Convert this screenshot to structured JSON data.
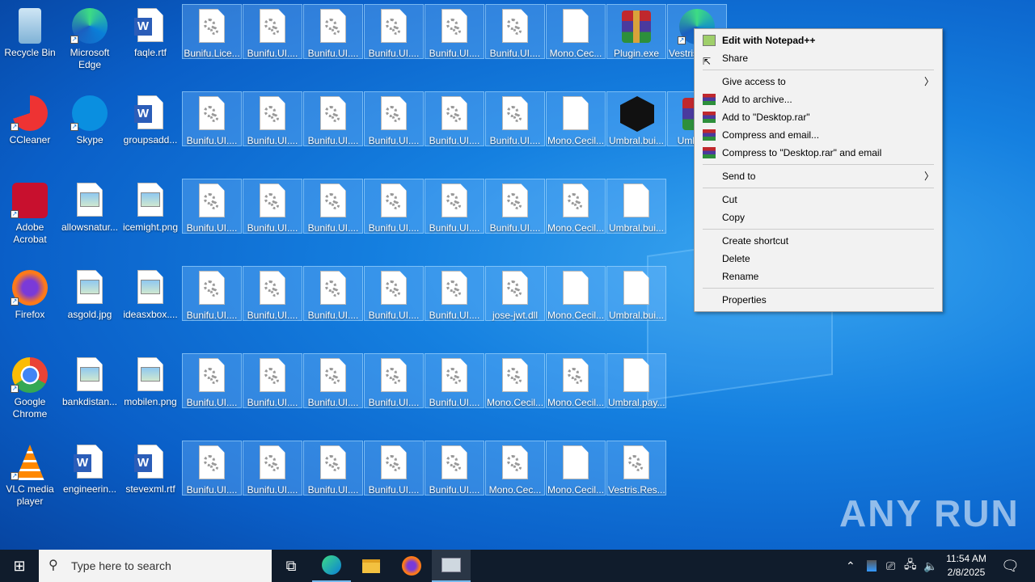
{
  "desktop": {
    "left_icons": [
      [
        {
          "label": "Recycle Bin",
          "icon": "recycle-bin"
        },
        {
          "label": "Microsoft Edge",
          "icon": "edge"
        },
        {
          "label": "faqle.rtf",
          "icon": "word"
        }
      ],
      [
        {
          "label": "CCleaner",
          "icon": "ccleaner"
        },
        {
          "label": "Skype",
          "icon": "skype"
        },
        {
          "label": "groupsadd...",
          "icon": "word"
        }
      ],
      [
        {
          "label": "Adobe Acrobat",
          "icon": "acrobat"
        },
        {
          "label": "allowsnatur...",
          "icon": "image"
        },
        {
          "label": "icemight.png",
          "icon": "image"
        }
      ],
      [
        {
          "label": "Firefox",
          "icon": "firefox"
        },
        {
          "label": "asgold.jpg",
          "icon": "image"
        },
        {
          "label": "ideasxbox....",
          "icon": "image"
        }
      ],
      [
        {
          "label": "Google Chrome",
          "icon": "chrome"
        },
        {
          "label": "bankdistan...",
          "icon": "image"
        },
        {
          "label": "mobilen.png",
          "icon": "image"
        }
      ],
      [
        {
          "label": "VLC media player",
          "icon": "vlc"
        },
        {
          "label": "engineerin...",
          "icon": "word"
        },
        {
          "label": "stevexml.rtf",
          "icon": "word"
        }
      ]
    ],
    "selected_icons": [
      [
        {
          "label": "Bunifu.Lice...",
          "icon": "gear"
        },
        {
          "label": "Bunifu.UI....",
          "icon": "gear"
        },
        {
          "label": "Bunifu.UI....",
          "icon": "gear"
        },
        {
          "label": "Bunifu.UI....",
          "icon": "gear"
        },
        {
          "label": "Bunifu.UI....",
          "icon": "gear"
        },
        {
          "label": "Bunifu.UI....",
          "icon": "gear"
        },
        {
          "label": "Mono.Cec...",
          "icon": "blank"
        },
        {
          "label": "Plugin.exe",
          "icon": "rar"
        },
        {
          "label": "Vestris.ResourceLi...",
          "icon": "edge"
        }
      ],
      [
        {
          "label": "Bunifu.UI....",
          "icon": "gear"
        },
        {
          "label": "Bunifu.UI....",
          "icon": "gear"
        },
        {
          "label": "Bunifu.UI....",
          "icon": "gear"
        },
        {
          "label": "Bunifu.UI....",
          "icon": "gear"
        },
        {
          "label": "Bunifu.UI....",
          "icon": "gear"
        },
        {
          "label": "Bunifu.UI....",
          "icon": "gear"
        },
        {
          "label": "Mono.Cecil...",
          "icon": "blank"
        },
        {
          "label": "Umbral.bui...",
          "icon": "dragon"
        },
        {
          "label": "Umbral...",
          "icon": "rar"
        }
      ],
      [
        {
          "label": "Bunifu.UI....",
          "icon": "gear"
        },
        {
          "label": "Bunifu.UI....",
          "icon": "gear"
        },
        {
          "label": "Bunifu.UI....",
          "icon": "gear"
        },
        {
          "label": "Bunifu.UI....",
          "icon": "gear"
        },
        {
          "label": "Bunifu.UI....",
          "icon": "gear"
        },
        {
          "label": "Bunifu.UI....",
          "icon": "gear"
        },
        {
          "label": "Mono.Cecil...",
          "icon": "gear"
        },
        {
          "label": "Umbral.bui...",
          "icon": "blank"
        }
      ],
      [
        {
          "label": "Bunifu.UI....",
          "icon": "gear"
        },
        {
          "label": "Bunifu.UI....",
          "icon": "gear"
        },
        {
          "label": "Bunifu.UI....",
          "icon": "gear"
        },
        {
          "label": "Bunifu.UI....",
          "icon": "gear"
        },
        {
          "label": "Bunifu.UI....",
          "icon": "gear"
        },
        {
          "label": "jose-jwt.dll",
          "icon": "gear"
        },
        {
          "label": "Mono.Cecil...",
          "icon": "blank"
        },
        {
          "label": "Umbral.bui...",
          "icon": "blank"
        }
      ],
      [
        {
          "label": "Bunifu.UI....",
          "icon": "gear"
        },
        {
          "label": "Bunifu.UI....",
          "icon": "gear"
        },
        {
          "label": "Bunifu.UI....",
          "icon": "gear"
        },
        {
          "label": "Bunifu.UI....",
          "icon": "gear"
        },
        {
          "label": "Bunifu.UI....",
          "icon": "gear"
        },
        {
          "label": "Mono.Cecil...",
          "icon": "gear"
        },
        {
          "label": "Mono.Cecil...",
          "icon": "gear"
        },
        {
          "label": "Umbral.pay...",
          "icon": "blank"
        }
      ],
      [
        {
          "label": "Bunifu.UI....",
          "icon": "gear"
        },
        {
          "label": "Bunifu.UI....",
          "icon": "gear"
        },
        {
          "label": "Bunifu.UI....",
          "icon": "gear"
        },
        {
          "label": "Bunifu.UI....",
          "icon": "gear"
        },
        {
          "label": "Bunifu.UI....",
          "icon": "gear"
        },
        {
          "label": "Mono.Cec...",
          "icon": "gear"
        },
        {
          "label": "Mono.Cecil...",
          "icon": "blank"
        },
        {
          "label": "Vestris.Res...",
          "icon": "gear"
        }
      ]
    ]
  },
  "context_menu": {
    "edit_notepad": "Edit with Notepad++",
    "share": "Share",
    "give_access": "Give access to",
    "add_archive": "Add to archive...",
    "add_desktop_rar": "Add to \"Desktop.rar\"",
    "compress_email": "Compress and email...",
    "compress_desktop_email": "Compress to \"Desktop.rar\" and email",
    "send_to": "Send to",
    "cut": "Cut",
    "copy": "Copy",
    "create_shortcut": "Create shortcut",
    "delete": "Delete",
    "rename": "Rename",
    "properties": "Properties"
  },
  "taskbar": {
    "search_placeholder": "Type here to search",
    "time": "11:54 AM",
    "date": "2/8/2025"
  },
  "watermark": "ANY RUN"
}
